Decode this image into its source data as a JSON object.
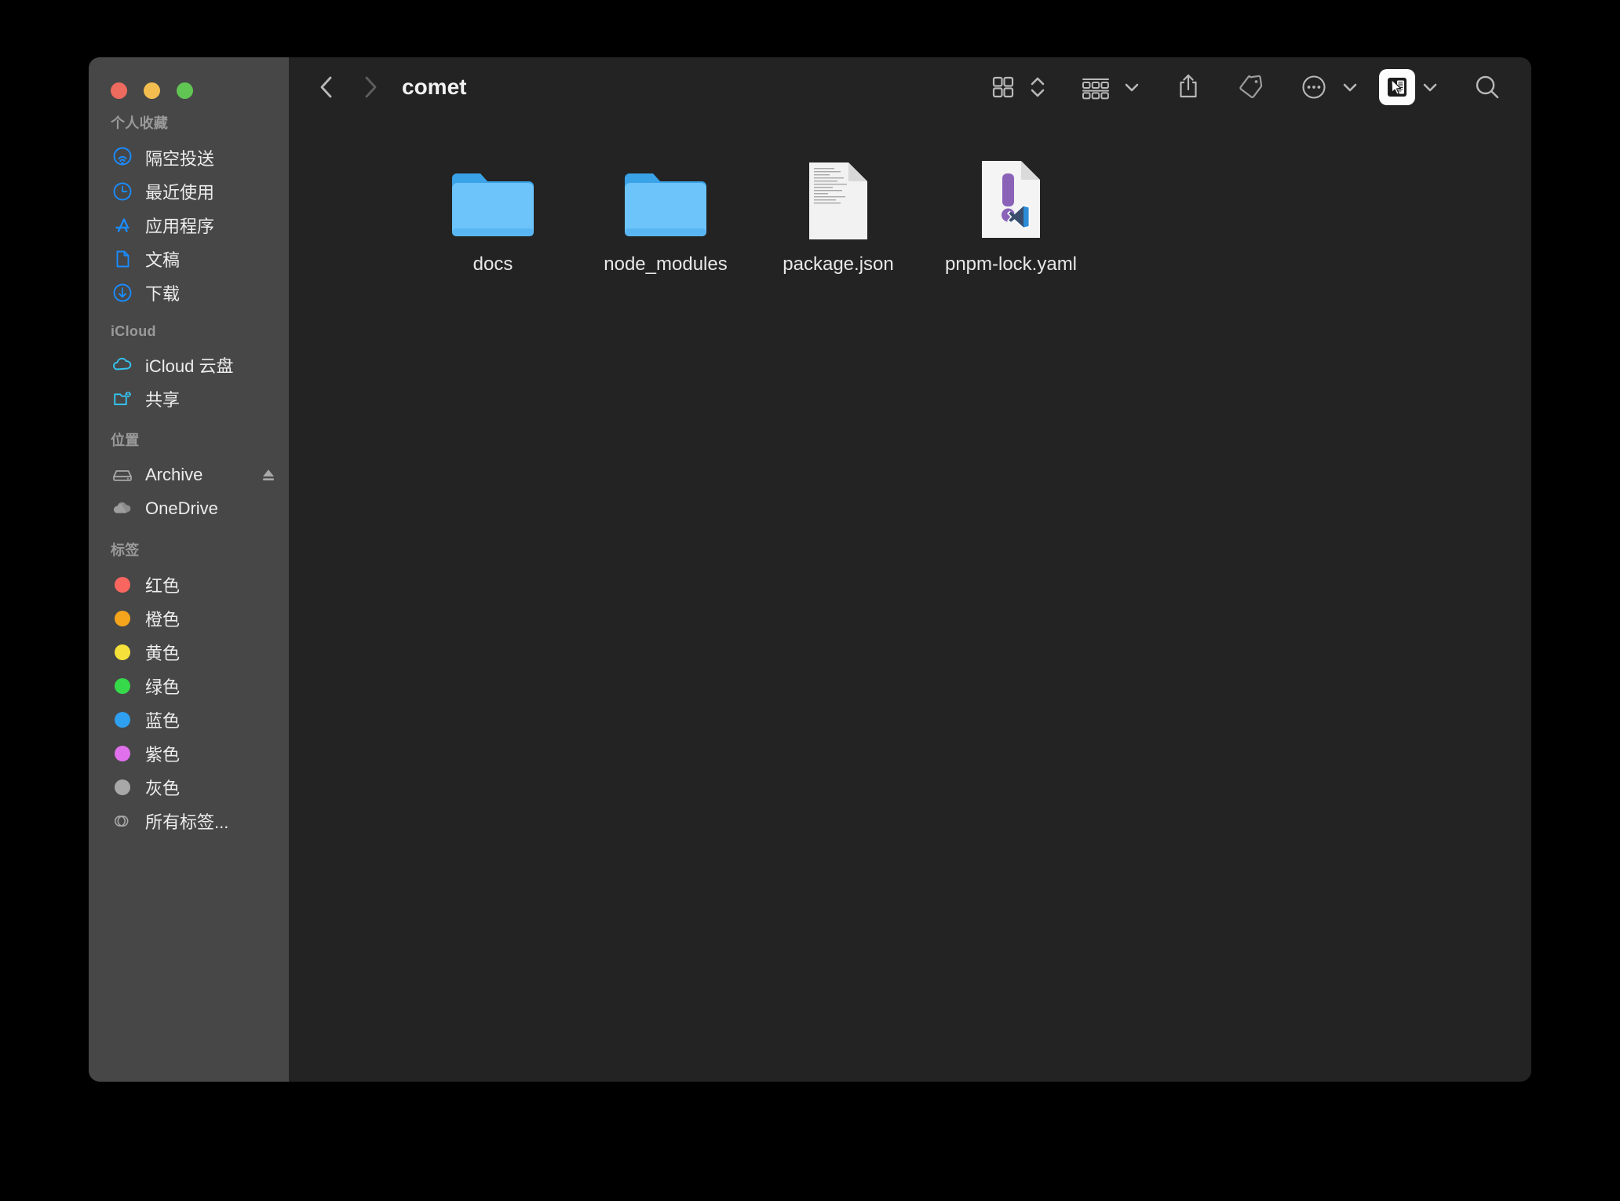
{
  "window": {
    "title": "comet",
    "traffic_lights": [
      {
        "name": "close",
        "color": "#ec6a5e"
      },
      {
        "name": "minimize",
        "color": "#f4bd4f"
      },
      {
        "name": "zoom",
        "color": "#61c554"
      }
    ]
  },
  "sidebar": {
    "sections": [
      {
        "title": "个人收藏",
        "items": [
          {
            "label": "隔空投送",
            "icon": "airdrop-icon",
            "color": "#1a8cff"
          },
          {
            "label": "最近使用",
            "icon": "clock-icon",
            "color": "#1a8cff"
          },
          {
            "label": "应用程序",
            "icon": "applications-icon",
            "color": "#1a8cff"
          },
          {
            "label": "文稿",
            "icon": "document-icon",
            "color": "#1a8cff"
          },
          {
            "label": "下载",
            "icon": "download-icon",
            "color": "#1a8cff"
          }
        ]
      },
      {
        "title": "iCloud",
        "items": [
          {
            "label": "iCloud 云盘",
            "icon": "cloud-icon",
            "color": "#35c4f0"
          },
          {
            "label": "共享",
            "icon": "shared-folder-icon",
            "color": "#35c4f0"
          }
        ]
      },
      {
        "title": "位置",
        "items": [
          {
            "label": "Archive",
            "icon": "hard-drive-icon",
            "color": "#a8a8a8",
            "eject": true
          },
          {
            "label": "OneDrive",
            "icon": "cloud-filled-icon",
            "color": "#a8a8a8"
          }
        ]
      },
      {
        "title": "标签",
        "items": [
          {
            "label": "红色",
            "icon": "tag-dot-icon",
            "color": "#f9655f"
          },
          {
            "label": "橙色",
            "icon": "tag-dot-icon",
            "color": "#f5a51c"
          },
          {
            "label": "黄色",
            "icon": "tag-dot-icon",
            "color": "#f6e13b"
          },
          {
            "label": "绿色",
            "icon": "tag-dot-icon",
            "color": "#36d94a"
          },
          {
            "label": "蓝色",
            "icon": "tag-dot-icon",
            "color": "#2f9ff0"
          },
          {
            "label": "紫色",
            "icon": "tag-dot-icon",
            "color": "#e070ec"
          },
          {
            "label": "灰色",
            "icon": "tag-dot-icon",
            "color": "#a8a8a8"
          },
          {
            "label": "所有标签...",
            "icon": "all-tags-icon",
            "color": "#a8a8a8"
          }
        ]
      }
    ]
  },
  "toolbar": {
    "back": "back-chevron",
    "forward": "forward-chevron",
    "buttons": [
      {
        "name": "icon-view-button",
        "icon": "grid-icon"
      },
      {
        "name": "view-options-stepper",
        "icon": "chevron-up-down-icon"
      },
      {
        "name": "group-by-button",
        "icon": "group-rows-icon"
      },
      {
        "name": "group-by-chevron",
        "icon": "chevron-down-icon"
      },
      {
        "name": "share-button",
        "icon": "share-icon"
      },
      {
        "name": "tag-button",
        "icon": "tag-icon"
      },
      {
        "name": "more-button",
        "icon": "ellipsis-circle-icon"
      },
      {
        "name": "more-chevron",
        "icon": "chevron-down-icon"
      },
      {
        "name": "quick-action-button",
        "icon": "cursor-document-icon"
      },
      {
        "name": "quick-action-chevron",
        "icon": "chevron-down-icon"
      },
      {
        "name": "search-button",
        "icon": "search-icon"
      }
    ]
  },
  "files": [
    {
      "name": "docs",
      "type": "folder"
    },
    {
      "name": "node_modules",
      "type": "folder"
    },
    {
      "name": "package.json",
      "type": "document"
    },
    {
      "name": "pnpm-lock.yaml",
      "type": "yaml-vscode"
    }
  ]
}
